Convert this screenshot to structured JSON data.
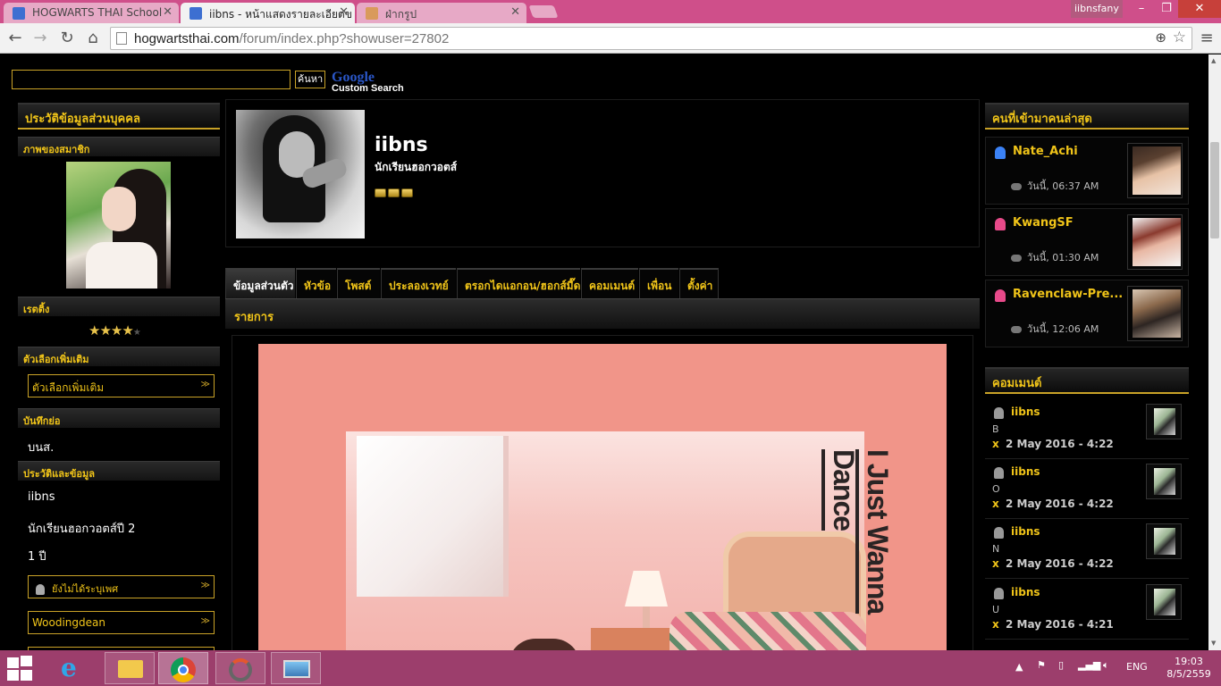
{
  "browser": {
    "tabs": [
      {
        "title": "HOGWARTS THAI School"
      },
      {
        "title": "iibns - หน้าแสดงรายละเอียดข"
      },
      {
        "title": "ฝ่ากรูป"
      }
    ],
    "profile_label": "iibnsfany",
    "url_host": "hogwartsthai.com",
    "url_path": "/forum/index.php?showuser=27802"
  },
  "search": {
    "button_label": "ค้นหา",
    "google_label": "Google",
    "custom_search_label": "Custom Search"
  },
  "left": {
    "profile_header": "ประวัติข้อมูลส่วนบุคคล",
    "photo_label": "ภาพของสมาชิก",
    "rating_label": "เรตติ้ง",
    "rating_value": 4,
    "rating_max": 5,
    "options_label": "ตัวเลือกเพิ่มเติม",
    "options_select": "ตัวเลือกเพิ่มเติม",
    "note_label": "บันทึกย่อ",
    "note_text": "บนส.",
    "info_label": "ประวัติและข้อมูล",
    "info_name": "iibns",
    "info_year": "นักเรียนฮอกวอตส์ปี 2",
    "info_age": "1 ปี",
    "gender_select": "ยังไม่ได้ระบุเพศ",
    "house_select": "Woodingdean"
  },
  "profile": {
    "name": "iibns",
    "title": "นักเรียนฮอกวอตส์",
    "rank_pips": 3
  },
  "tabs": [
    {
      "label": "ข้อมูลส่วนตัว"
    },
    {
      "label": "หัวข้อ"
    },
    {
      "label": "โพสต์"
    },
    {
      "label": "ประลองเวทย์"
    },
    {
      "label": "ตรอกไดแอกอน/ฮอกส์มี๊ด"
    },
    {
      "label": "คอมเมนต์"
    },
    {
      "label": "เพื่อน"
    },
    {
      "label": "ตั้งค่า"
    }
  ],
  "list_header": "รายการ",
  "album": {
    "line1": "I Just Wanna",
    "line2": "Dance"
  },
  "right": {
    "visitors_header": "คนที่เข้ามาคนล่าสุด",
    "visitors": [
      {
        "name": "Nate_Achi",
        "time": "วันนี้, 06:37 AM",
        "icon_color": "#3b82f6"
      },
      {
        "name": "KwangSF",
        "time": "วันนี้, 01:30 AM",
        "icon_color": "#e84a8a"
      },
      {
        "name": "Ravenclaw-Pre...",
        "time": "วันนี้, 12:06 AM",
        "icon_color": "#e84a8a"
      }
    ],
    "comments_header": "คอมเมนต์",
    "comments": [
      {
        "name": "iibns",
        "body": "B",
        "del": "x",
        "date": "2 May 2016 - 4:22"
      },
      {
        "name": "iibns",
        "body": "O",
        "del": "x",
        "date": "2 May 2016 - 4:22"
      },
      {
        "name": "iibns",
        "body": "N",
        "del": "x",
        "date": "2 May 2016 - 4:22"
      },
      {
        "name": "iibns",
        "body": "U",
        "del": "x",
        "date": "2 May 2016 - 4:21"
      }
    ]
  },
  "taskbar": {
    "lang": "ENG",
    "time": "19:03",
    "date": "8/5/2559"
  },
  "colors": {
    "accent_gold": "#f0c419",
    "tab_bar": "#cf4f8a",
    "taskbar": "#9c3e6c"
  }
}
